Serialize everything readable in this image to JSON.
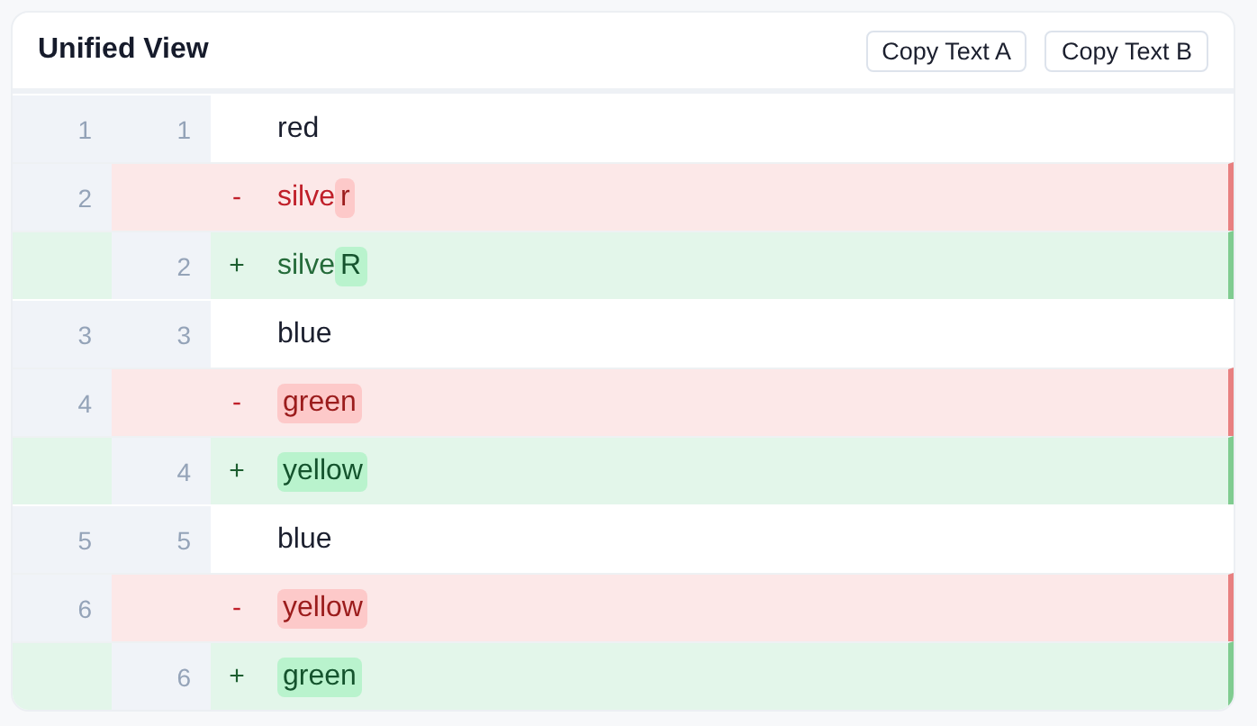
{
  "header": {
    "title": "Unified View",
    "buttons": [
      "Copy Text A",
      "Copy Text B"
    ]
  },
  "rows": [
    {
      "kind": "same",
      "old": "1",
      "new": "1",
      "segments": [
        {
          "text": "red",
          "changed": false
        }
      ]
    },
    {
      "kind": "removed",
      "old": "2",
      "sign": "-",
      "segments": [
        {
          "text": "silve",
          "changed": false
        },
        {
          "text": "r",
          "changed": true
        }
      ]
    },
    {
      "kind": "added",
      "new": "2",
      "sign": "+",
      "segments": [
        {
          "text": "silve",
          "changed": false
        },
        {
          "text": "R",
          "changed": true
        }
      ]
    },
    {
      "kind": "same",
      "old": "3",
      "new": "3",
      "segments": [
        {
          "text": "blue",
          "changed": false
        }
      ]
    },
    {
      "kind": "removed",
      "old": "4",
      "sign": "-",
      "segments": [
        {
          "text": "green",
          "changed": true
        }
      ]
    },
    {
      "kind": "added",
      "new": "4",
      "sign": "+",
      "segments": [
        {
          "text": "yellow",
          "changed": true
        }
      ]
    },
    {
      "kind": "same",
      "old": "5",
      "new": "5",
      "segments": [
        {
          "text": "blue",
          "changed": false
        }
      ]
    },
    {
      "kind": "removed",
      "old": "6",
      "sign": "-",
      "segments": [
        {
          "text": "yellow",
          "changed": true
        }
      ]
    },
    {
      "kind": "added",
      "new": "6",
      "sign": "+",
      "segments": [
        {
          "text": "green",
          "changed": true
        }
      ]
    }
  ]
}
